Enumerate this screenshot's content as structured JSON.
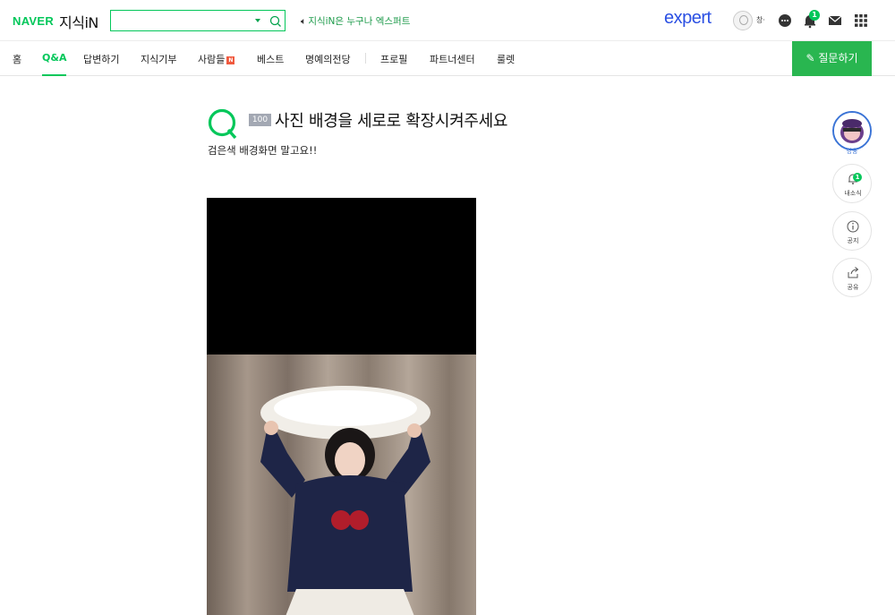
{
  "header": {
    "naver_logo": "NAVER",
    "service_logo": "지식iN",
    "search_placeholder": "",
    "notice": "지식iN은 누구나 엑스퍼트",
    "expert_logo": "expert",
    "user_name": "창·",
    "alarm_count": "1"
  },
  "nav": {
    "items": [
      "홈",
      "Q&A",
      "답변하기",
      "지식기부",
      "사람들",
      "베스트",
      "명예의전당",
      "프로필",
      "파트너센터",
      "룰렛"
    ],
    "new_badge": "N",
    "ask_button": "질문하기"
  },
  "question": {
    "mark": "Q",
    "points": "100",
    "title": "사진 배경을 세로로 확장시켜주세요",
    "body": "검은색 배경화면 말고요!!"
  },
  "side": {
    "profile_label": "영웅",
    "alarm_label": "내소식",
    "alarm_count": "1",
    "notice_label": "공지",
    "share_label": "공유"
  },
  "colors": {
    "brand_green": "#03c75a",
    "ask_button": "#29b650",
    "expert_blue": "#2b50e3",
    "points_badge": "#a3a8b3"
  }
}
